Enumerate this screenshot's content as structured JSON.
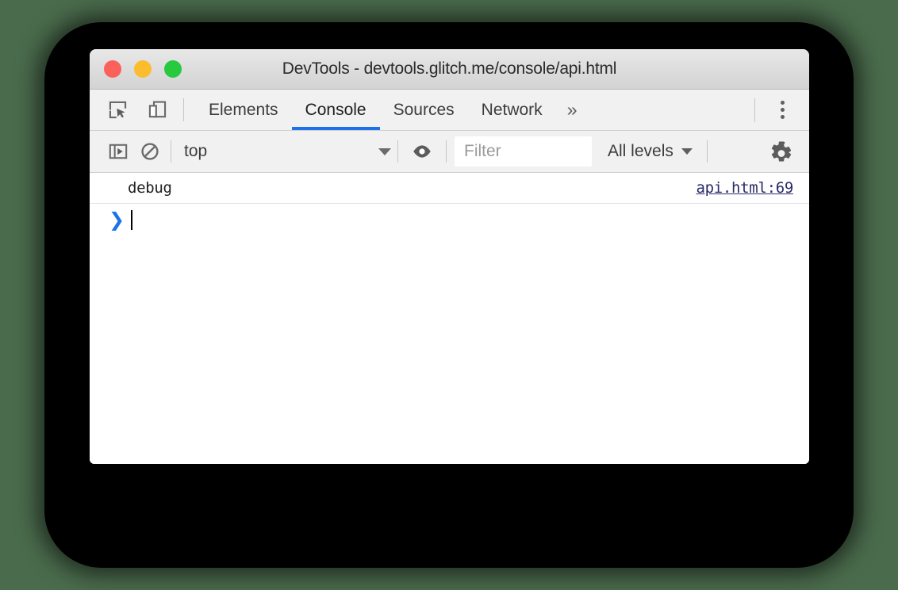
{
  "window": {
    "title": "DevTools - devtools.glitch.me/console/api.html",
    "traffic_lights": [
      {
        "name": "close",
        "color": "#f9615a"
      },
      {
        "name": "minimize",
        "color": "#fbbd2e"
      },
      {
        "name": "maximize",
        "color": "#27c93f"
      }
    ]
  },
  "tabbar": {
    "icons": [
      {
        "name": "inspect-element-icon",
        "title": "Inspect"
      },
      {
        "name": "device-toolbar-icon",
        "title": "Toggle device toolbar"
      }
    ],
    "tabs": [
      {
        "id": "elements",
        "label": "Elements",
        "active": false
      },
      {
        "id": "console",
        "label": "Console",
        "active": true
      },
      {
        "id": "sources",
        "label": "Sources",
        "active": false
      },
      {
        "id": "network",
        "label": "Network",
        "active": false
      }
    ],
    "overflow_label": "»",
    "menu_icon": "kebab-menu-icon",
    "active_underline_color": "#1a73e8"
  },
  "console_toolbar": {
    "sidebar_toggle_icon": "console-sidebar-icon",
    "clear_icon": "clear-console-icon",
    "context": {
      "value": "top",
      "caret": "▼"
    },
    "eye_icon": "create-live-expression-icon",
    "filter": {
      "value": "",
      "placeholder": "Filter"
    },
    "levels": {
      "value": "All levels",
      "caret": "▼"
    },
    "settings_icon": "settings-gear-icon"
  },
  "console": {
    "messages": [
      {
        "text": "debug",
        "source": "api.html:69",
        "level": "debug"
      }
    ],
    "prompt": {
      "arrow": "❯",
      "value": ""
    }
  },
  "colors": {
    "page_background": "#4a6b4c",
    "plate": "#000000",
    "toolbar": "#f1f1f1",
    "accent": "#1a73e8",
    "link": "#2b2b6b"
  }
}
